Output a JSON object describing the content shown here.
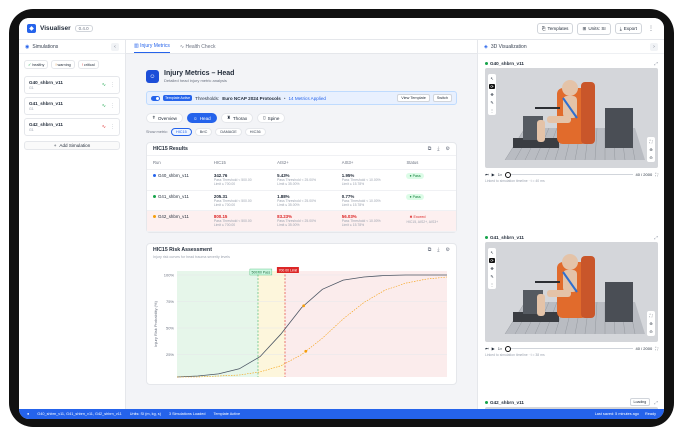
{
  "app": {
    "name": "Visualiser",
    "version": "0.4.0"
  },
  "topbar": {
    "templates": "Templates",
    "units": "Units: SI",
    "export": "Export"
  },
  "left": {
    "title": "Simulations",
    "chips": [
      {
        "label": "healthy",
        "icon": "✓",
        "color": "#16a34a"
      },
      {
        "label": "warning",
        "icon": "!",
        "color": "#d97706"
      },
      {
        "label": "critical",
        "icon": "!",
        "color": "#dc2626"
      }
    ],
    "sims": [
      {
        "name": "G40_shbrn_v11",
        "sub": "G1"
      },
      {
        "name": "G41_shbrn_v11",
        "sub": "G1"
      },
      {
        "name": "G42_shbrn_v11",
        "sub": "G1"
      }
    ],
    "add": "Add Simulation"
  },
  "main": {
    "tabs": [
      "Injury Metrics",
      "Health Check"
    ],
    "title": "Injury Metrics – Head",
    "subtitle": "Detailed head injury metric analysis",
    "banner": {
      "tag": "Template Active",
      "label": "Thresholds:",
      "protocol": "Euro NCAP 2024 Protocols",
      "count": "14 Metrics Applied",
      "view": "View Template",
      "switch": "Switch"
    },
    "regions": [
      {
        "label": "Overview",
        "icon": "✝"
      },
      {
        "label": "Head",
        "icon": "☺"
      },
      {
        "label": "Thorax",
        "icon": "♜"
      },
      {
        "label": "Spine",
        "icon": "▯"
      }
    ],
    "metrics_label": "Show metric:",
    "metrics": [
      "HIC15",
      "BrIC",
      "DAMAGE",
      "HIC36"
    ],
    "results": {
      "title": "HIC15 Results",
      "columns": [
        "Run",
        "HIC15",
        "AIS2+",
        "AIS3+",
        "Status"
      ],
      "rows": [
        {
          "run": "G40_shbrn_v11",
          "dot": "#2563eb",
          "hic": "342.76",
          "hic_a": "Pass Threshold < 500.00",
          "hic_b": "Limit ≤ 700.00",
          "ais2": "5.43%",
          "ais2_a": "Pass Threshold < 25.00%",
          "ais2_b": "Limit ≤ 35.00%",
          "ais3": "1.95%",
          "ais3_a": "Pass Threshold < 10.00%",
          "ais3_b": "Limit ≤ 15.78%",
          "status": "Pass",
          "fail": false,
          "note": ""
        },
        {
          "run": "G41_shbrn_v11",
          "dot": "#16a34a",
          "hic": "205.31",
          "hic_a": "Pass Threshold < 500.00",
          "hic_b": "Limit ≤ 700.00",
          "ais2": "1.88%",
          "ais2_a": "Pass Threshold < 25.00%",
          "ais2_b": "Limit ≤ 35.00%",
          "ais3": "0.77%",
          "ais3_a": "Pass Threshold < 10.00%",
          "ais3_b": "Limit ≤ 15.78%",
          "status": "Pass",
          "fail": false,
          "note": ""
        },
        {
          "run": "G42_shbrn_v11",
          "dot": "#f59e0b",
          "hic": "800.15",
          "hic_a": "Pass Threshold < 500.00",
          "hic_b": "Limit ≤ 700.00",
          "ais2": "83.23%",
          "ais2_a": "Pass Threshold < 25.00%",
          "ais2_b": "Limit ≤ 35.00%",
          "ais3": "56.03%",
          "ais3_a": "Pass Threshold < 10.00%",
          "ais3_b": "Limit ≤ 15.78%",
          "status": "Exceed",
          "fail": true,
          "note": "HIC15, AIS2+, AIS3+"
        }
      ]
    },
    "risk": {
      "title": "HIC15 Risk Assessment",
      "subtitle": "Injury risk curves for head trauma severity levels",
      "ylabel": "Injury Risk Probability (%)",
      "pass_label": "500.00 Pass",
      "limit_label": "700.00 Limit"
    }
  },
  "chart_data": {
    "type": "line",
    "title": "HIC15 Risk Assessment",
    "ylabel": "Injury Risk Probability (%)",
    "y_ticks": [
      "100%",
      "75%",
      "50%",
      "25%"
    ],
    "ylim": [
      0,
      100
    ],
    "series": [
      {
        "values": [
          0,
          1,
          3,
          8,
          20,
          42,
          68,
          86,
          95,
          98,
          99.5,
          100,
          100,
          100
        ]
      },
      {
        "values": [
          0,
          0,
          1,
          2,
          5,
          11,
          22,
          38,
          57,
          73,
          85,
          92,
          96,
          98
        ]
      }
    ],
    "points": [
      {
        "series": 0,
        "index": 6.1,
        "color": "#f59e0b"
      },
      {
        "series": 1,
        "index": 6.2,
        "color": "#f59e0b"
      }
    ]
  },
  "right": {
    "title": "3D Visualization",
    "views": [
      {
        "name": "G40_shbrn_v11",
        "frame": "40 / 2000",
        "info": "Linked to simulation timeline",
        "time": "t = 40 ms"
      },
      {
        "name": "G41_shbrn_v11",
        "frame": "40 / 2000",
        "info": "Linked to simulation timeline",
        "time": "t = 38 ms"
      },
      {
        "name": "G42_shbrn_v11",
        "loading": "Loading"
      }
    ]
  },
  "statusbar": {
    "runs": "G40_shbrn_v11, G41_shbrn_v11, G42_shbrn_v11",
    "units": "Units: SI (m, kg, s)",
    "loaded": "3 Simulations Loaded",
    "template": "Template Active",
    "updated": "Last saved: 5 minutes ago",
    "ready": "Ready"
  }
}
